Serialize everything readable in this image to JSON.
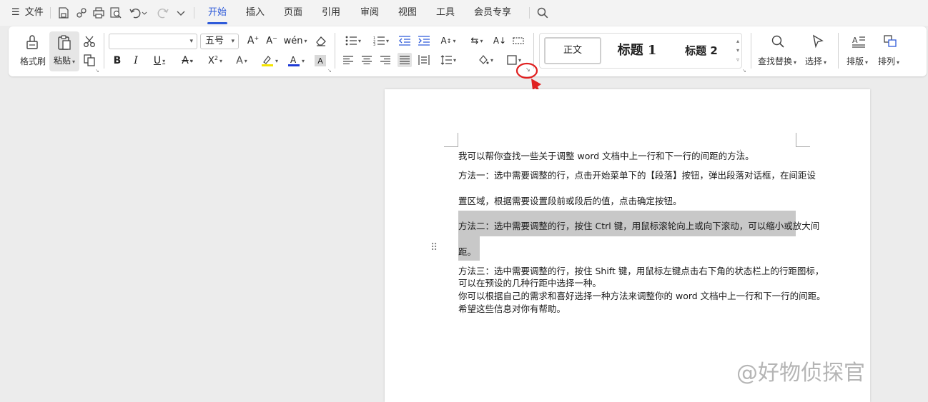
{
  "menubar": {
    "file_label": "文件",
    "menu_icon": "hamburger-icon",
    "tabs": [
      {
        "label": "开始",
        "active": true
      },
      {
        "label": "插入"
      },
      {
        "label": "页面"
      },
      {
        "label": "引用"
      },
      {
        "label": "审阅"
      },
      {
        "label": "视图"
      },
      {
        "label": "工具"
      },
      {
        "label": "会员专享"
      }
    ]
  },
  "ribbon": {
    "format_painter_label": "格式刷",
    "paste_label": "粘贴",
    "font_name": "",
    "font_size": "五号",
    "styles": {
      "normal": "正文",
      "heading1": "标题 1",
      "heading2": "标题 2"
    },
    "find_replace_label": "查找替换",
    "select_label": "选择",
    "layout_label": "排版",
    "arrange_label": "排列",
    "accent_color": "#2f5bd9",
    "highlight_color": "#f5e400",
    "font_color": "#1f3bd6",
    "annotation_color": "#e02020"
  },
  "document": {
    "paragraphs": [
      "我可以帮你查找一些关于调整 word 文档中上一行和下一行的间距的方法。",
      "方法一：选中需要调整的行，点击开始菜单下的【段落】按钮，弹出段落对话框，在间距设",
      "置区域，根据需要设置段前或段后的值，点击确定按钮。",
      "方法二：选中需要调整的行，按住 Ctrl 键，用鼠标滚轮向上或向下滚动，可以缩小或放大间",
      "距。",
      "方法三：选中需要调整的行，按住 Shift 键，用鼠标左键点击右下角的状态栏上的行距图标，",
      "可以在预设的几种行距中选择一种。",
      "你可以根据自己的需求和喜好选择一种方法来调整你的 word 文档中上一行和下一行的间距。",
      "希望这些信息对你有帮助。"
    ]
  },
  "watermark": "@好物侦探官"
}
